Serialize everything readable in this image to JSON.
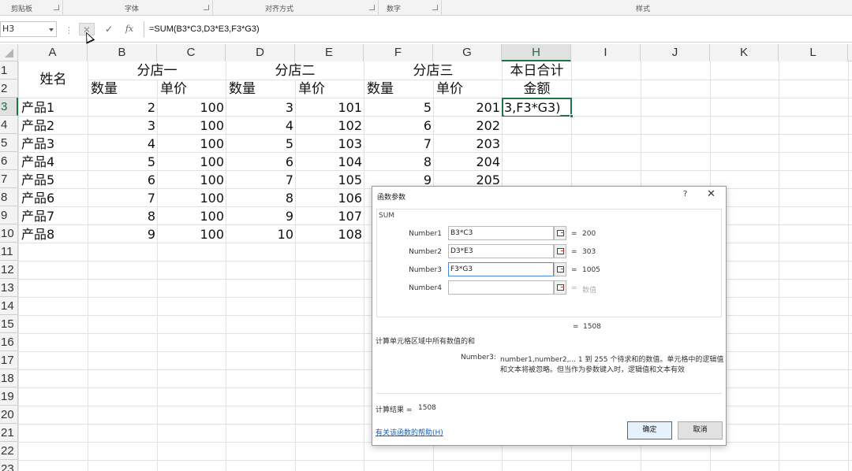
{
  "ribbon": {
    "groups": [
      {
        "label": "剪贴板"
      },
      {
        "label": "字体"
      },
      {
        "label": "对齐方式"
      },
      {
        "label": "数字"
      },
      {
        "label": "样式"
      }
    ]
  },
  "formula_bar": {
    "name_box": "H3",
    "cancel_icon": "✕",
    "enter_icon": "✓",
    "fx_label": "fx",
    "formula": "=SUM(B3*C3,D3*E3,F3*G3)"
  },
  "grid": {
    "columns": [
      "A",
      "B",
      "C",
      "D",
      "E",
      "F",
      "G",
      "H",
      "I",
      "J",
      "K",
      "L"
    ],
    "rows": [
      "1",
      "2",
      "3",
      "4",
      "5",
      "6",
      "7",
      "8",
      "9",
      "10",
      "11",
      "12",
      "13",
      "14",
      "15",
      "16",
      "17",
      "18",
      "19",
      "20",
      "21",
      "22",
      "23"
    ],
    "selected_column": "H",
    "selected_row": "3",
    "header": {
      "name": "姓名",
      "store1": "分店一",
      "store2": "分店二",
      "store3": "分店三",
      "daily_total": "本日合计",
      "amount": "金额",
      "qty": "数量",
      "price": "单价"
    },
    "data_rows": [
      {
        "name": "产品1",
        "b": "2",
        "c": "100",
        "d": "3",
        "e": "101",
        "f": "5",
        "g": "201"
      },
      {
        "name": "产品2",
        "b": "3",
        "c": "100",
        "d": "4",
        "e": "102",
        "f": "6",
        "g": "202"
      },
      {
        "name": "产品3",
        "b": "4",
        "c": "100",
        "d": "5",
        "e": "103",
        "f": "7",
        "g": "203"
      },
      {
        "name": "产品4",
        "b": "5",
        "c": "100",
        "d": "6",
        "e": "104",
        "f": "8",
        "g": "204"
      },
      {
        "name": "产品5",
        "b": "6",
        "c": "100",
        "d": "7",
        "e": "105",
        "f": "9",
        "g": "205"
      },
      {
        "name": "产品6",
        "b": "7",
        "c": "100",
        "d": "8",
        "e": "106",
        "f": "",
        "g": ""
      },
      {
        "name": "产品7",
        "b": "8",
        "c": "100",
        "d": "9",
        "e": "107",
        "f": "",
        "g": ""
      },
      {
        "name": "产品8",
        "b": "9",
        "c": "100",
        "d": "10",
        "e": "108",
        "f": "",
        "g": ""
      }
    ],
    "active_cell_text": "3,F3*G3)"
  },
  "dialog": {
    "title": "函数参数",
    "help_icon": "?",
    "close_icon": "✕",
    "function_name": "SUM",
    "args": [
      {
        "label": "Number1",
        "value": "B3*C3",
        "result": "200"
      },
      {
        "label": "Number2",
        "value": "D3*E3",
        "result": "303"
      },
      {
        "label": "Number3",
        "value": "F3*G3",
        "result": "1005"
      },
      {
        "label": "Number4",
        "value": "",
        "result": "数值"
      }
    ],
    "equals": "=",
    "total": "1508",
    "description": "计算单元格区域中所有数值的和",
    "arg_name": "Number3:",
    "arg_desc_line1": "number1,number2,...  1 到 255 个待求和的数值。单元格中的逻辑值",
    "arg_desc_line2": "和文本将被忽略。但当作为参数键入时，逻辑值和文本有效",
    "result_label": "计算结果 =",
    "result_value": "1508",
    "help_link": "有关该函数的帮助(H)",
    "ok_label": "确定",
    "cancel_label": "取消"
  }
}
